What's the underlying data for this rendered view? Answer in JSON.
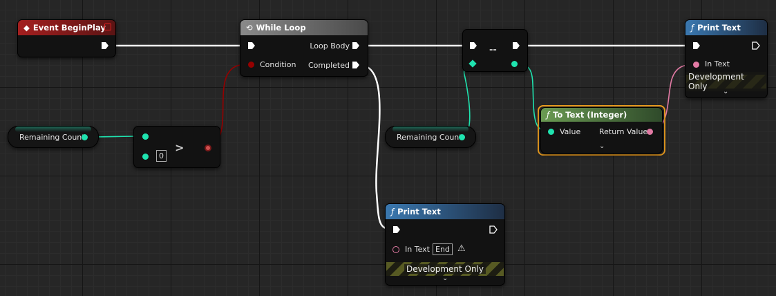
{
  "nodes": {
    "event_begin_play": {
      "title": "Event BeginPlay"
    },
    "while_loop": {
      "title": "While Loop",
      "loop_body": "Loop Body",
      "condition": "Condition",
      "completed": "Completed"
    },
    "greater": {
      "symbol": ">",
      "literal": "0"
    },
    "decrement": {
      "symbol": "--"
    },
    "remaining_count_1": {
      "label": "Remaining Count"
    },
    "remaining_count_2": {
      "label": "Remaining Count"
    },
    "to_text": {
      "title": "To Text (Integer)",
      "value": "Value",
      "return_value": "Return Value"
    },
    "print_text_top": {
      "title": "Print Text",
      "in_text": "In Text",
      "dev_only": "Development Only"
    },
    "print_text_bottom": {
      "title": "Print Text",
      "in_text": "In Text",
      "in_text_value": "End",
      "dev_only": "Development Only"
    }
  },
  "icons": {
    "event": "diamond-event-icon",
    "loop": "loop-icon",
    "function": "function-icon",
    "warning": "warning-icon"
  },
  "colors": {
    "exec": "#ffffff",
    "integer": "#1fe3af",
    "bool": "#950000",
    "text": "#e27aa4",
    "event_header": "#8d1c1c",
    "loop_header": "#6e6e6e",
    "function_header": "#2f6596",
    "to_text_header": "#5e8a4c",
    "selection": "#f0a020"
  }
}
